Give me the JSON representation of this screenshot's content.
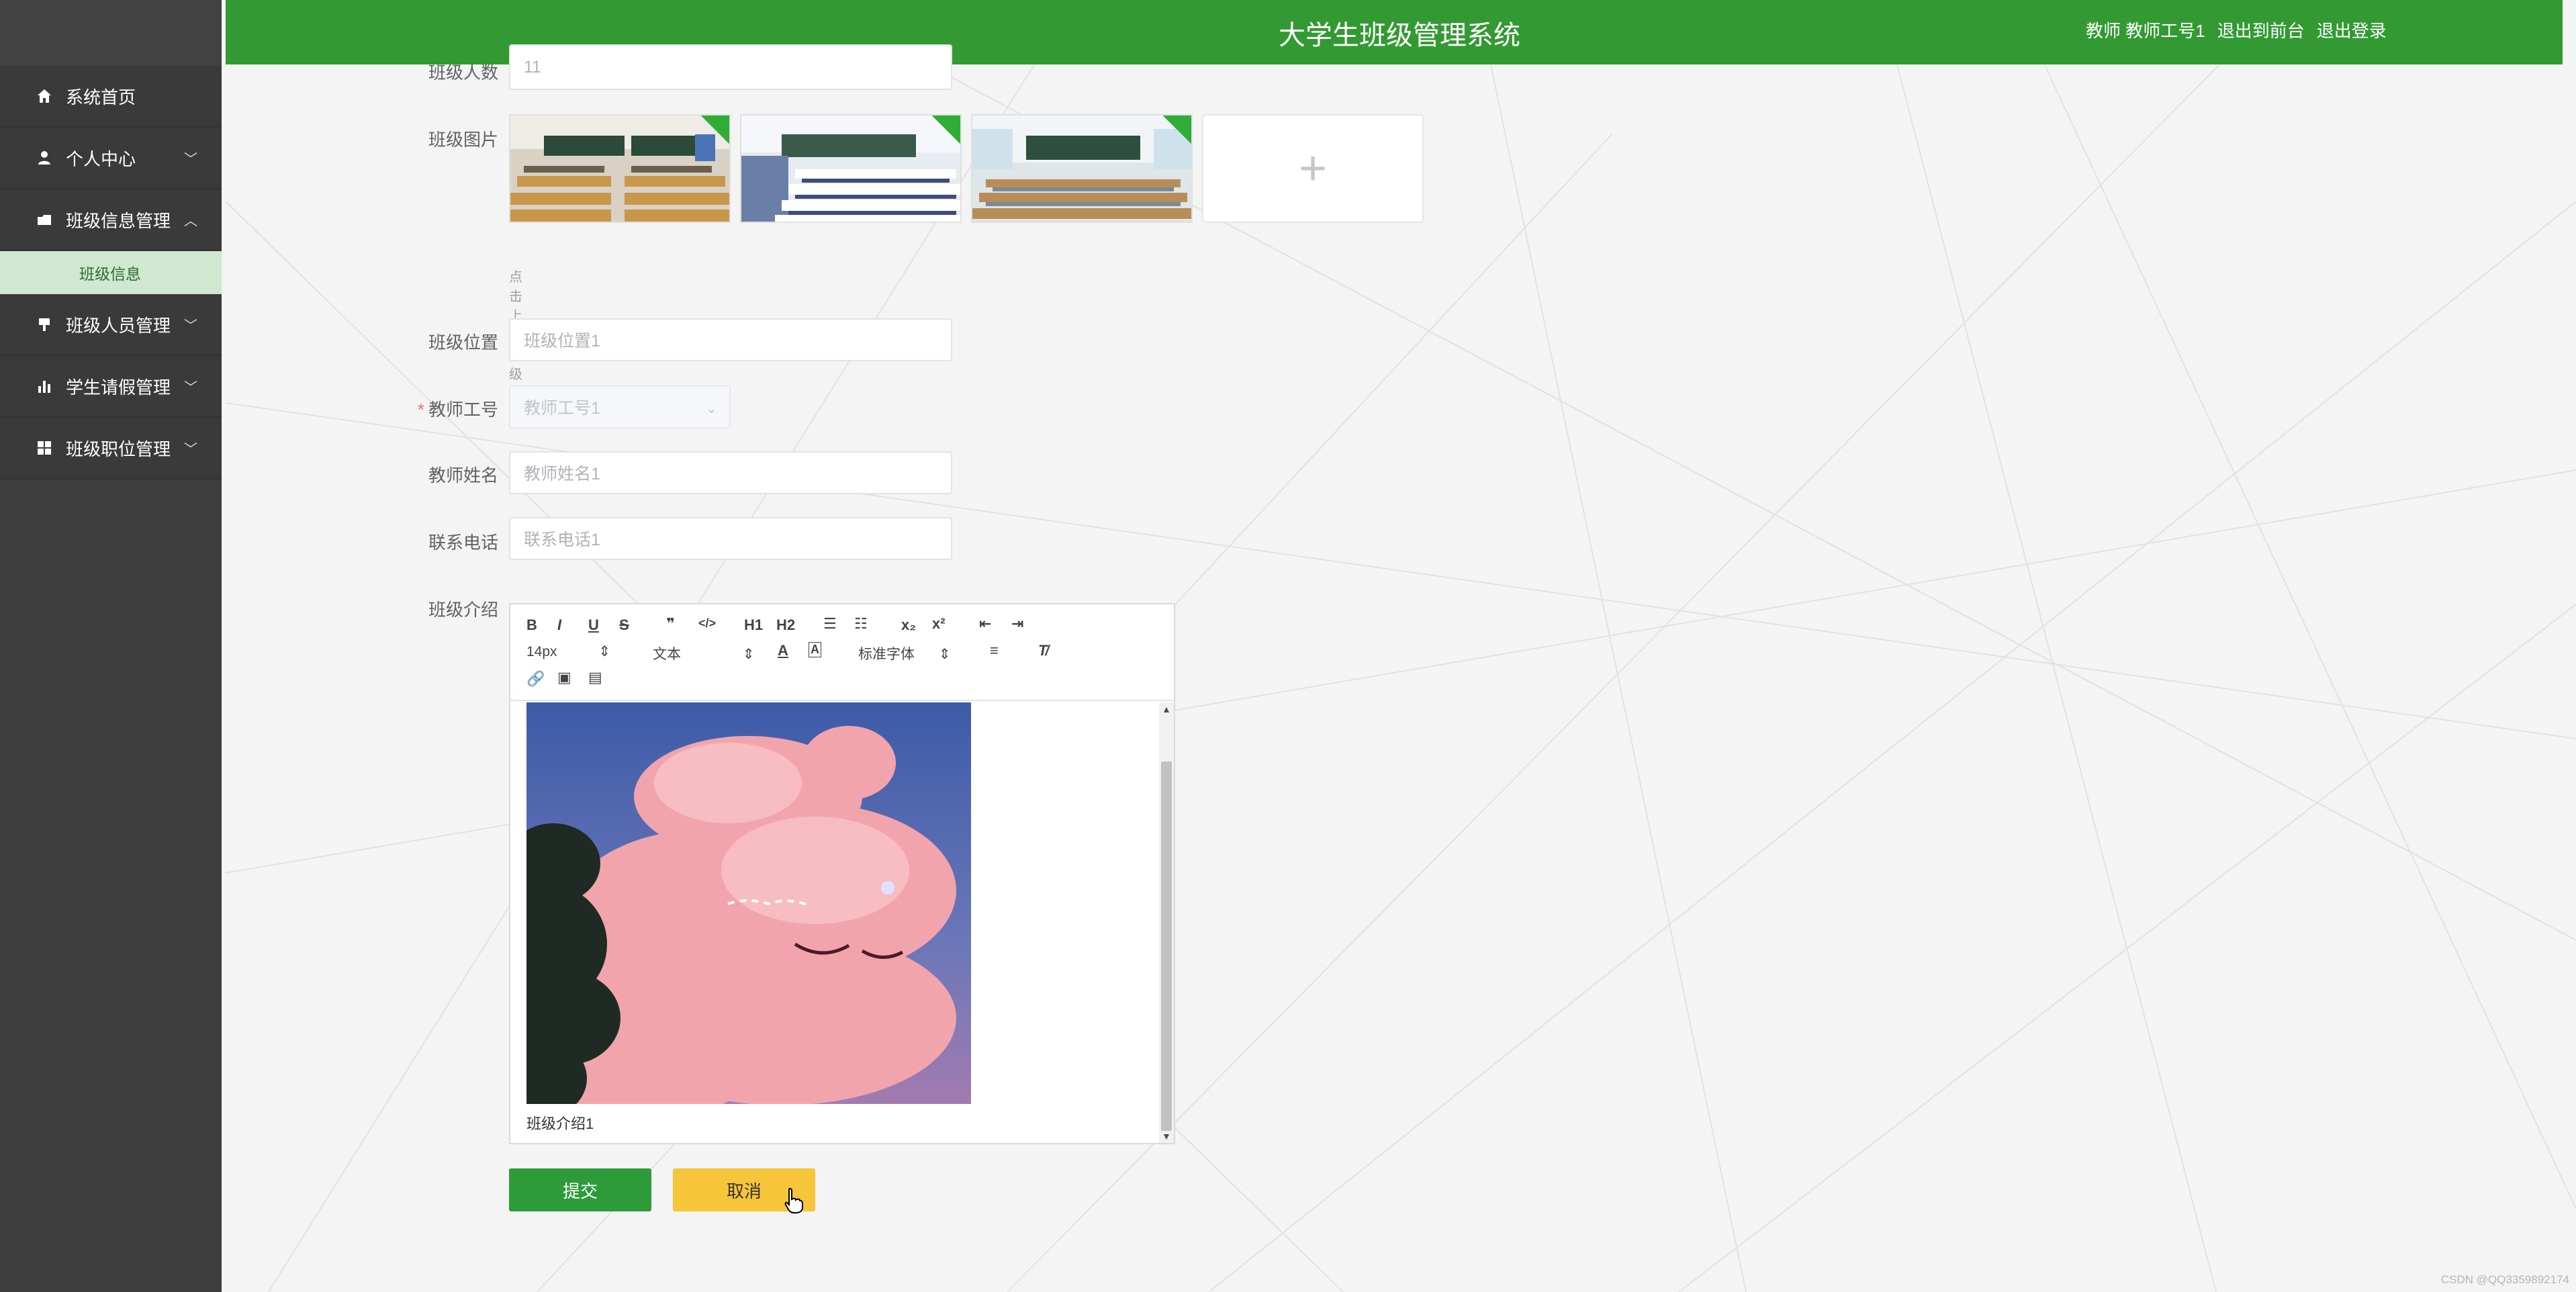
{
  "header": {
    "title": "大学生班级管理系统",
    "user_label": "教师 教师工号1",
    "to_frontend": "退出到前台",
    "logout": "退出登录"
  },
  "sidebar": {
    "items": [
      {
        "label": "系统首页",
        "icon": "home-icon"
      },
      {
        "label": "个人中心",
        "icon": "user-icon"
      },
      {
        "label": "班级信息管理",
        "icon": "folder-icon",
        "expanded": true
      },
      {
        "label": "班级人员管理",
        "icon": "flag-icon"
      },
      {
        "label": "学生请假管理",
        "icon": "bar-chart-icon"
      },
      {
        "label": "班级职位管理",
        "icon": "grid-icon"
      }
    ],
    "submenu": {
      "label": "班级信息"
    }
  },
  "form": {
    "class_size_label": "班级人数",
    "class_size_value": "11",
    "class_images_label": "班级图片",
    "upload_hint": "点击上传班级图片",
    "location_label": "班级位置",
    "location_value": "班级位置1",
    "teacher_id_label": "教师工号",
    "teacher_id_value": "教师工号1",
    "teacher_name_label": "教师姓名",
    "teacher_name_value": "教师姓名1",
    "phone_label": "联系电话",
    "phone_value": "联系电话1",
    "intro_label": "班级介绍",
    "intro_text": "班级介绍1"
  },
  "editor": {
    "font_size": "14px",
    "paragraph": "文本",
    "font_family": "标准字体",
    "h1": "H1",
    "h2": "H2"
  },
  "buttons": {
    "submit": "提交",
    "cancel": "取消"
  },
  "watermark": "CSDN @QQ3359892174"
}
